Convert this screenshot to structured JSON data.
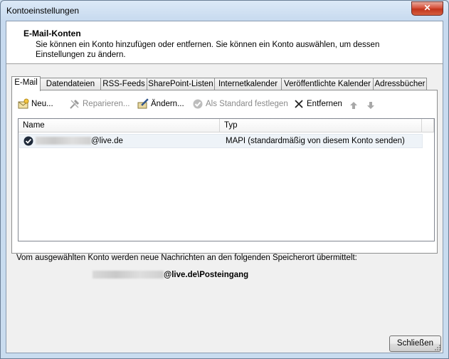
{
  "window": {
    "title": "Kontoeinstellungen",
    "close_label": "✕"
  },
  "header": {
    "title": "E-Mail-Konten",
    "description": "Sie können ein Konto hinzufügen oder entfernen. Sie können ein Konto auswählen, um dessen Einstellungen zu ändern."
  },
  "tabs": [
    {
      "label": "E-Mail"
    },
    {
      "label": "Datendateien"
    },
    {
      "label": "RSS-Feeds"
    },
    {
      "label": "SharePoint-Listen"
    },
    {
      "label": "Internetkalender"
    },
    {
      "label": "Veröffentlichte Kalender"
    },
    {
      "label": "Adressbücher"
    }
  ],
  "toolbar": {
    "new_label": "Neu...",
    "repair_label": "Reparieren...",
    "change_label": "Ändern...",
    "default_label": "Als Standard festlegen",
    "remove_label": "Entfernen"
  },
  "list": {
    "columns": {
      "name": "Name",
      "type": "Typ"
    },
    "rows": [
      {
        "name_suffix": "@live.de",
        "type": "MAPI (standardmäßig von diesem Konto senden)"
      }
    ]
  },
  "delivery": {
    "info": "Vom ausgewählten Konto werden neue Nachrichten an den folgenden Speicherort übermittelt:",
    "path_suffix": "@live.de\\Posteingang"
  },
  "footer": {
    "close_button_label": "Schließen"
  },
  "colors": {
    "window_frame": "#c9dcef",
    "close_red": "#c1351c",
    "selected_row": "#eef3f8"
  }
}
